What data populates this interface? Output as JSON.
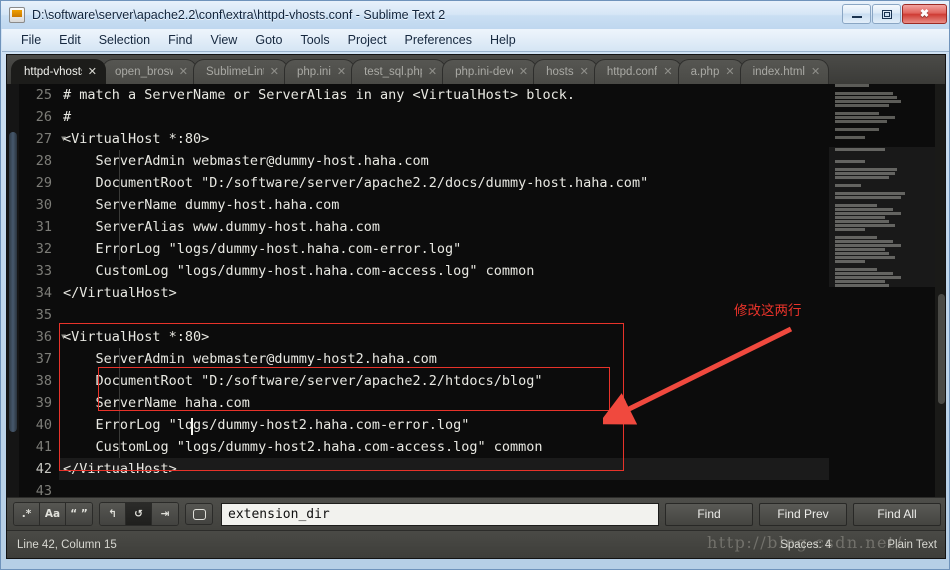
{
  "window": {
    "title": "D:\\software\\server\\apache2.2\\conf\\extra\\httpd-vhosts.conf - Sublime Text 2",
    "minimize_label": "–",
    "maximize_label": "▣",
    "close_label": "✕"
  },
  "menu": {
    "items": [
      "File",
      "Edit",
      "Selection",
      "Find",
      "View",
      "Goto",
      "Tools",
      "Project",
      "Preferences",
      "Help"
    ]
  },
  "tabs": [
    {
      "label": "httpd-vhosts",
      "close": "✕",
      "active": true
    },
    {
      "label": "open_broswe",
      "close": "✕",
      "active": false
    },
    {
      "label": "SublimeLinte",
      "close": "✕",
      "active": false
    },
    {
      "label": "php.ini",
      "close": "✕",
      "active": false
    },
    {
      "label": "test_sql.php",
      "close": "✕",
      "active": false
    },
    {
      "label": "php.ini-deve",
      "close": "✕",
      "active": false
    },
    {
      "label": "hosts",
      "close": "✕",
      "active": false
    },
    {
      "label": "httpd.conf",
      "close": "✕",
      "active": false
    },
    {
      "label": "a.php",
      "close": "✕",
      "active": false
    },
    {
      "label": "index.html",
      "close": "✕",
      "active": false
    }
  ],
  "editor": {
    "lines": [
      {
        "num": "25",
        "text": "# match a ServerName or ServerAlias in any <VirtualHost> block.",
        "fold": false,
        "current": false
      },
      {
        "num": "26",
        "text": "#",
        "fold": false,
        "current": false
      },
      {
        "num": "27",
        "text": "<VirtualHost *:80>",
        "fold": true,
        "current": false
      },
      {
        "num": "28",
        "text": "    ServerAdmin webmaster@dummy-host.haha.com",
        "fold": false,
        "current": false
      },
      {
        "num": "29",
        "text": "    DocumentRoot \"D:/software/server/apache2.2/docs/dummy-host.haha.com\"",
        "fold": false,
        "current": false
      },
      {
        "num": "30",
        "text": "    ServerName dummy-host.haha.com",
        "fold": false,
        "current": false
      },
      {
        "num": "31",
        "text": "    ServerAlias www.dummy-host.haha.com",
        "fold": false,
        "current": false
      },
      {
        "num": "32",
        "text": "    ErrorLog \"logs/dummy-host.haha.com-error.log\"",
        "fold": false,
        "current": false
      },
      {
        "num": "33",
        "text": "    CustomLog \"logs/dummy-host.haha.com-access.log\" common",
        "fold": false,
        "current": false
      },
      {
        "num": "34",
        "text": "</VirtualHost>",
        "fold": false,
        "current": false
      },
      {
        "num": "35",
        "text": "",
        "fold": false,
        "current": false
      },
      {
        "num": "36",
        "text": "<VirtualHost *:80>",
        "fold": true,
        "current": false
      },
      {
        "num": "37",
        "text": "    ServerAdmin webmaster@dummy-host2.haha.com",
        "fold": false,
        "current": false
      },
      {
        "num": "38",
        "text": "    DocumentRoot \"D:/software/server/apache2.2/htdocs/blog\"",
        "fold": false,
        "current": false
      },
      {
        "num": "39",
        "text": "    ServerName haha.com",
        "fold": false,
        "current": false
      },
      {
        "num": "40",
        "text": "    ErrorLog \"logs/dummy-host2.haha.com-error.log\"",
        "fold": false,
        "current": false
      },
      {
        "num": "41",
        "text": "    CustomLog \"logs/dummy-host2.haha.com-access.log\" common",
        "fold": false,
        "current": false
      },
      {
        "num": "42",
        "text": "</VirtualHost>",
        "fold": false,
        "current": true
      },
      {
        "num": "43",
        "text": "",
        "fold": false,
        "current": false
      }
    ],
    "fold_glyph": "▼"
  },
  "annotation": {
    "text": "修改这两行",
    "color": "#e8332a"
  },
  "find": {
    "value": "extension_dir",
    "placeholder": "Find",
    "options": [
      {
        "name": "regex",
        "label": ".*",
        "on": false
      },
      {
        "name": "case-sensitive",
        "label": "Aa",
        "on": false
      },
      {
        "name": "whole-word",
        "label": "“ ”",
        "on": false
      }
    ],
    "modes": [
      {
        "name": "wrap",
        "label": "↰",
        "on": false
      },
      {
        "name": "in-selection",
        "label": "↺",
        "on": true
      },
      {
        "name": "highlight",
        "label": "⇥",
        "on": false
      }
    ],
    "buttons": [
      "Find",
      "Find Prev",
      "Find All"
    ]
  },
  "status": {
    "position": "Line 42, Column 15",
    "indent": "Spaces: 4",
    "syntax": "Plain Text",
    "watermark": "http://blog.csdn.net/"
  }
}
